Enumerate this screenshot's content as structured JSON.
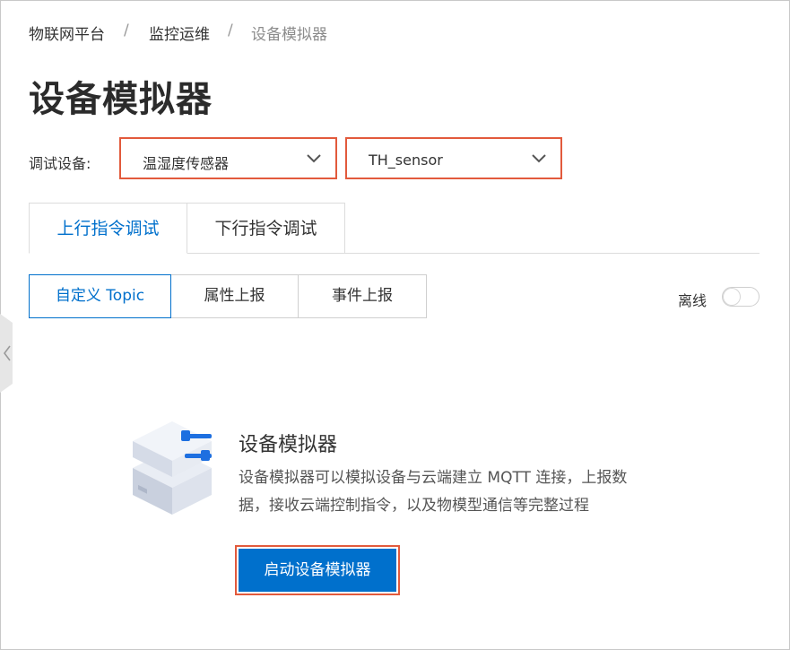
{
  "breadcrumb": {
    "items": [
      "物联网平台",
      "监控运维",
      "设备模拟器"
    ],
    "separator": "/"
  },
  "page_title": "设备模拟器",
  "debug_device": {
    "label": "调试设备:",
    "product_select": {
      "value": "温湿度传感器"
    },
    "device_select": {
      "value": "TH_sensor"
    }
  },
  "main_tabs": [
    {
      "label": "上行指令调试",
      "active": true
    },
    {
      "label": "下行指令调试",
      "active": false
    }
  ],
  "sub_tabs": [
    {
      "label": "自定义 Topic",
      "active": true
    },
    {
      "label": "属性上报",
      "active": false
    },
    {
      "label": "事件上报",
      "active": false
    }
  ],
  "status": {
    "label": "离线",
    "toggle_on": false
  },
  "empty_state": {
    "icon": "device-simulator-illustration",
    "title": "设备模拟器",
    "description_line1": "设备模拟器可以模拟设备与云端建立 MQTT 连接，上报数",
    "description_line2": "据，接收云端控制指令，以及物模型通信等完整过程",
    "button_label": "启动设备模拟器"
  },
  "colors": {
    "accent": "#0070cc",
    "highlight": "#e25a3c"
  }
}
